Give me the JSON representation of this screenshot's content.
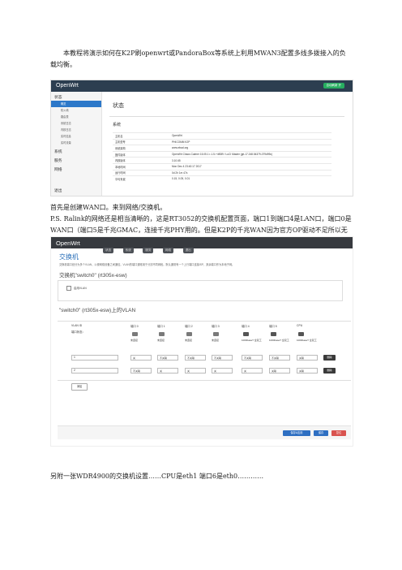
{
  "intro": "本教程将演示如何在K2P刷openwrt或PandoraBox等系统上利用MWAN3配置多线多拨接入的负载均衡。",
  "shot1": {
    "brand": "OpenWrt",
    "badge": "自动刷新 开",
    "menu": [
      {
        "label": "状态",
        "sub": [
          "概览",
          "防火墙",
          "路由表",
          "系统日志",
          "内核日志",
          "实时信息",
          "实时流量"
        ]
      },
      {
        "label": "系统",
        "sub": []
      },
      {
        "label": "服务",
        "sub": []
      },
      {
        "label": "网络",
        "sub": []
      }
    ],
    "logout": "退出",
    "heading": "状态",
    "section": "系统",
    "rows": [
      [
        "主机名",
        "OpenWrt"
      ],
      [
        "主机型号",
        "PHICOMM K2P"
      ],
      [
        "系统架构",
        "www.ebad.org"
      ],
      [
        "固件版本",
        "OpenWrt Chaos Calmer 15.05.1 r-1.5-+4f089 / LuCI Master (git-17.248.54379-079d99c)"
      ],
      [
        "内核版本",
        "3.10.65"
      ],
      [
        "本地时间",
        "Mon Dec 4 23:40:17 2017"
      ],
      [
        "运行时间",
        "0d 2h 1m 47s"
      ],
      [
        "平均负载",
        "0.15, 0.05, 0.01"
      ]
    ]
  },
  "text2": {
    "line1": "首先是创建WAN口。来到网络/交换机。",
    "line2": "P.S. Ralink的网络还是相当清晰的，这是RT3052的交换机配置页面，端口1到端口4是LAN口，端口0是WAN口（端口5是千兆GMAC，连接千兆PHY用的。但是K2P的千兆WAN因为官方OP驱动不足所以无法使用），CPU口连接着CPU的eth0。具体怎么看 下面讲解……"
  },
  "shot2": {
    "brand": "OpenWrt",
    "nav": [
      "状态",
      "系统",
      "服务",
      "网络",
      "退出"
    ],
    "title": "交换机",
    "desc": "交换机端口划分为多个VLAN，以便网络设备之间通信。VLAN的端口通常用于分割不同网段。默认通常有一个上行端口连接ISP，其余端口作为本地子网。",
    "switch_heading": "交换机\"switch0\" (rt305x-esw)",
    "enable_vlan": "启用VLAN",
    "vlan_heading": "\"switch0\" (rt305x-esw)上的VLAN",
    "columns": [
      "VLAN ID",
      "端口 0",
      "端口 1",
      "端口 2",
      "端口 3",
      "端口 4",
      "端口 5",
      "CPU"
    ],
    "port_state": "端口状态：",
    "port_status": [
      "未连接",
      "未连接",
      "未连接",
      "未连接",
      "1000baseT 全双工",
      "1000baseT 全双工",
      "1000baseT 全双工"
    ],
    "vlans": [
      {
        "id": "1",
        "values": [
          "关",
          "不关联",
          "不关联",
          "不关联",
          "不关联",
          "不关联",
          "关联"
        ]
      },
      {
        "id": "2",
        "values": [
          "不关联",
          "关",
          "关",
          "关",
          "关",
          "关联",
          "关联"
        ]
      }
    ],
    "delete_label": "删除",
    "add_label": "添加",
    "buttons": [
      "保存&应用",
      "保存",
      "复位"
    ]
  },
  "footer": "另附一张WDR4900的交换机设置……CPU是eth1 端口6是eth0…………"
}
